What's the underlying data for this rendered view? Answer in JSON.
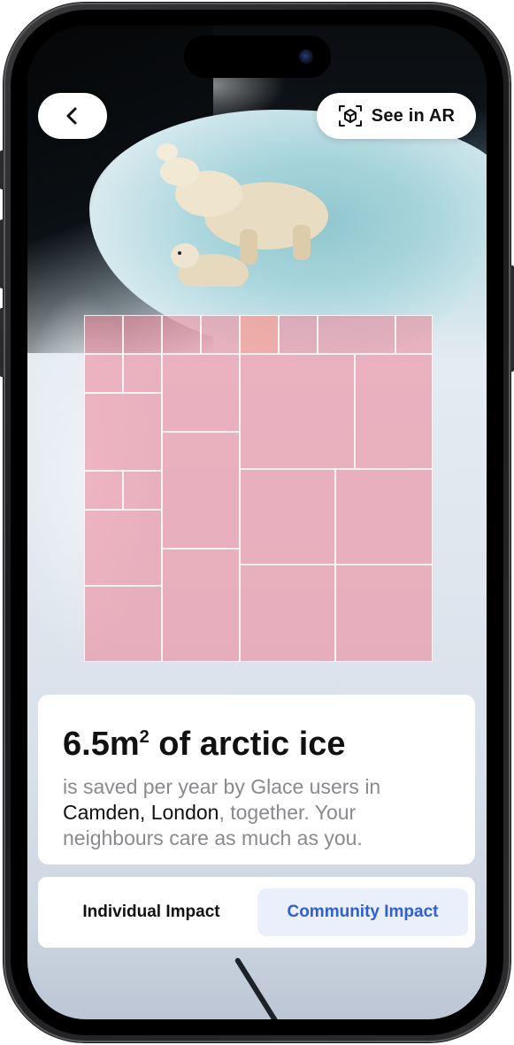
{
  "header": {
    "back_icon": "chevron-left-icon",
    "ar_button_label": "See in AR",
    "ar_icon": "ar-cube-icon"
  },
  "impact": {
    "amount": "6.5m",
    "amount_superscript": "2",
    "headline_suffix": " of arctic ice",
    "desc_prefix": "is saved per year by Glace users in ",
    "location": "Camden, London",
    "desc_suffix": ", together. Your neighbours care as much as you."
  },
  "tabs": {
    "individual_label": "Individual Impact",
    "community_label": "Community Impact",
    "active": "community"
  },
  "colors": {
    "accent": "#2f5fd0",
    "active_tab_bg": "#e9effb",
    "grid_fill": "#ee8296",
    "grid_highlight": "#f49e96"
  }
}
